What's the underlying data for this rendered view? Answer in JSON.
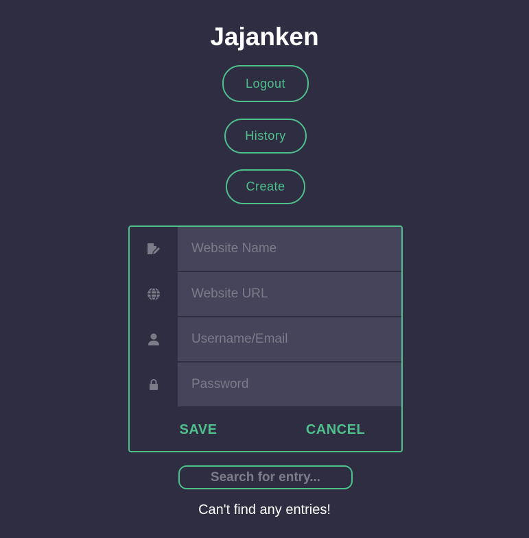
{
  "app": {
    "title": "Jajanken"
  },
  "nav": {
    "logout_label": "Logout",
    "history_label": "History",
    "create_label": "Create"
  },
  "form": {
    "website_name_placeholder": "Website Name",
    "website_url_placeholder": "Website URL",
    "username_placeholder": "Username/Email",
    "password_placeholder": "Password",
    "save_label": "SAVE",
    "cancel_label": "CANCEL",
    "icons": [
      "edit-document-icon",
      "globe-icon",
      "user-icon",
      "lock-icon"
    ]
  },
  "search": {
    "placeholder": "Search for entry..."
  },
  "entries": {
    "empty_message": "Can't find any entries!"
  },
  "colors": {
    "background": "#2e2d41",
    "accent": "#4ec08c",
    "input_background": "#45445a",
    "icon": "#7c7b89",
    "text": "#ffffff"
  }
}
